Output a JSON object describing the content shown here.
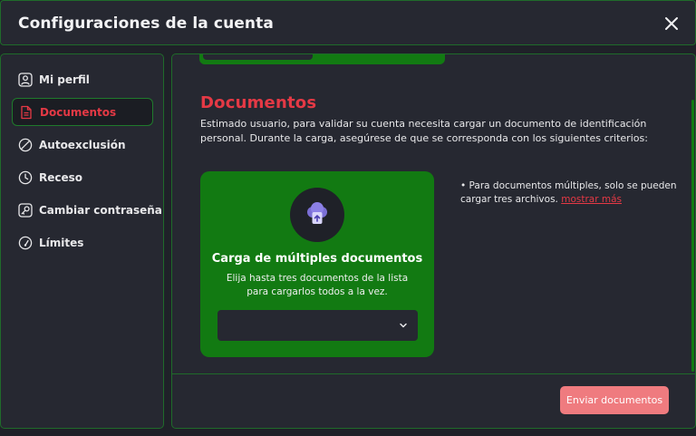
{
  "header": {
    "title": "Configuraciones de la cuenta"
  },
  "sidebar": {
    "items": [
      {
        "label": "Mi perfil",
        "icon": "user-icon",
        "active": false
      },
      {
        "label": "Documentos",
        "icon": "document-icon",
        "active": true
      },
      {
        "label": "Autoexclusión",
        "icon": "prohibited-icon",
        "active": false
      },
      {
        "label": "Receso",
        "icon": "clock-icon",
        "active": false
      },
      {
        "label": "Cambiar contraseña",
        "icon": "key-icon",
        "active": false
      },
      {
        "label": "Límites",
        "icon": "gauge-icon",
        "active": false
      }
    ]
  },
  "main": {
    "title": "Documentos",
    "description": "Estimado usuario, para validar su cuenta necesita cargar un documento de identificación personal. Durante la carga, asegúrese de que se corresponda con los siguientes criterios:",
    "upload_card": {
      "title": "Carga de múltiples documentos",
      "subtitle": "Elija hasta tres documentos de la lista para cargarlos todos a la vez.",
      "select_value": ""
    },
    "note": {
      "text": "• Para documentos múltiples, solo se pueden cargar tres archivos. ",
      "link": "mostrar más"
    },
    "submit_label": "Enviar documentos"
  },
  "colors": {
    "accent_red": "#e53945",
    "card_green": "#127a12",
    "border_green": "#1f6b2a",
    "panel_bg": "#262831",
    "submit_bg": "#ef7b7f"
  }
}
